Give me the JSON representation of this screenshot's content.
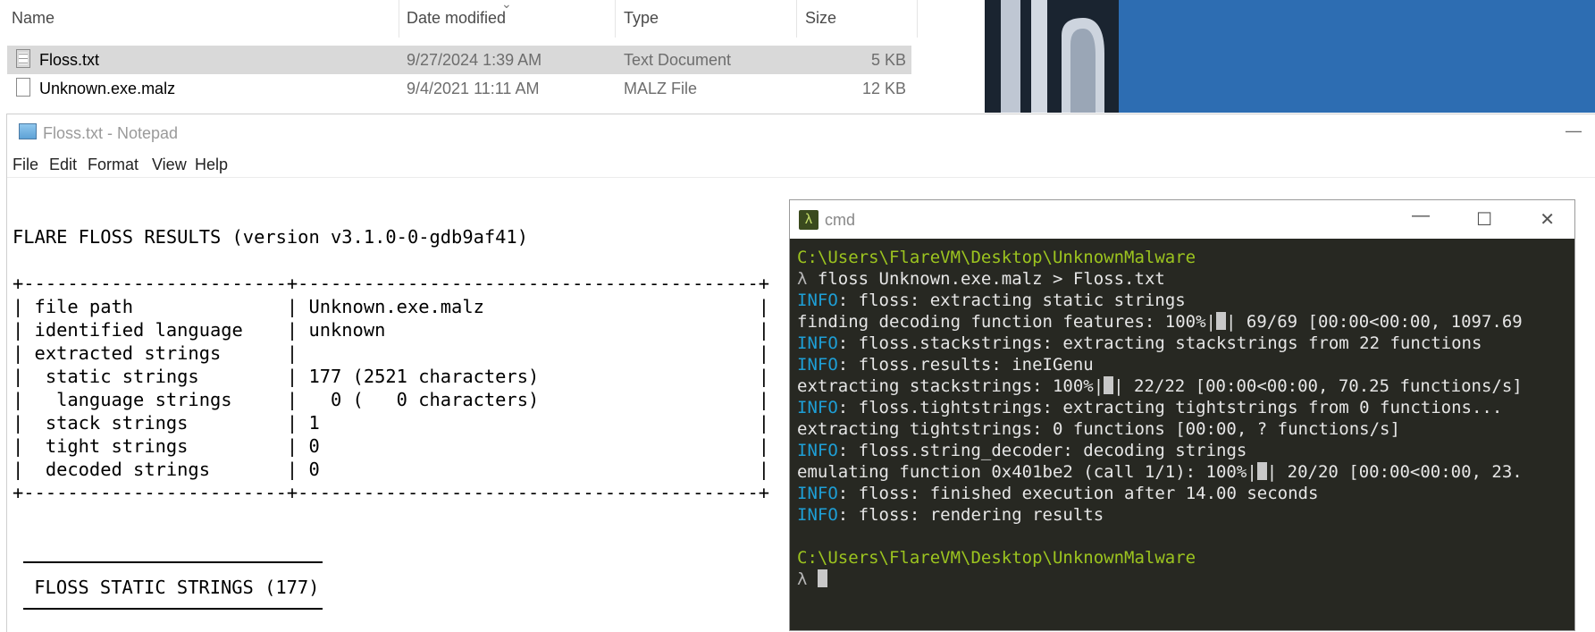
{
  "explorer": {
    "columns": {
      "name": "Name",
      "date": "Date modified",
      "type": "Type",
      "size": "Size"
    },
    "files": [
      {
        "name": "Floss.txt",
        "date": "9/27/2024 1:39 AM",
        "type": "Text Document",
        "size": "5 KB"
      },
      {
        "name": "Unknown.exe.malz",
        "date": "9/4/2021 11:11 AM",
        "type": "MALZ File",
        "size": "12 KB"
      }
    ]
  },
  "notepad": {
    "title": "Floss.txt - Notepad",
    "menu": [
      "File",
      "Edit",
      "Format",
      "View",
      "Help"
    ],
    "lines": {
      "header": "FLARE FLOSS RESULTS (version v3.1.0-0-gdb9af41)",
      "border": "+------------------------+------------------------------------------+",
      "r1": "| file path              | Unknown.exe.malz                         |",
      "r2": "| identified language    | unknown                                  |",
      "r3": "| extracted strings      |                                          |",
      "r4": "|  static strings        | 177 (2521 characters)                    |",
      "r5": "|   language strings     |   0 (   0 characters)                    |",
      "r6": "|  stack strings         | 1                                        |",
      "r7": "|  tight strings         | 0                                        |",
      "r8": "|  decoded strings       | 0                                        |",
      "border2": "+------------------------+------------------------------------------+",
      "static_heading": " FLOSS STATIC STRINGS (177)"
    }
  },
  "cmd": {
    "title": "cmd",
    "prompt_path": "C:\\Users\\FlareVM\\Desktop\\UnknownMalware",
    "lambda": "λ",
    "command": " floss Unknown.exe.malz > Floss.txt",
    "info": "INFO",
    "l1": ": floss: extracting static strings",
    "l2a": "finding decoding function features: 100%|",
    "l2b": "| 69/69 [00:00<00:00, 1097.69",
    "l3": ": floss.stackstrings: extracting stackstrings from 22 functions",
    "l4": ": floss.results: ineIGenu",
    "l5a": "extracting stackstrings: 100%|",
    "l5b": "| 22/22 [00:00<00:00, 70.25 functions/s]",
    "l6": ": floss.tightstrings: extracting tightstrings from 0 functions...",
    "l7": "extracting tightstrings: 0 functions [00:00, ? functions/s]",
    "l8": ": floss.string_decoder: decoding strings",
    "l9a": "emulating function 0x401be2 (call 1/1): 100%|",
    "l9b": "| 20/20 [00:00<00:00, 23.",
    "l10": ": floss: finished execution after 14.00 seconds",
    "l11": ": floss: rendering results"
  }
}
